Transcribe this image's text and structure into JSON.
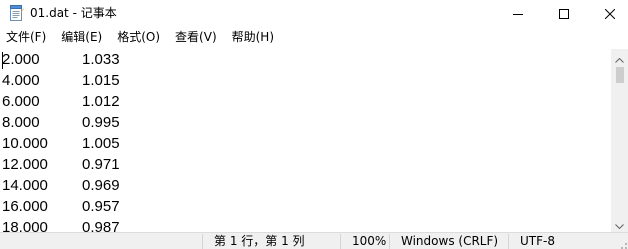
{
  "window": {
    "title": "01.dat - 记事本"
  },
  "menu": {
    "file": "文件(F)",
    "edit": "编辑(E)",
    "format": "格式(O)",
    "view": "查看(V)",
    "help": "帮助(H)"
  },
  "editor": {
    "rows": [
      {
        "x": "2.000",
        "y": "1.033"
      },
      {
        "x": "4.000",
        "y": "1.015"
      },
      {
        "x": "6.000",
        "y": "1.012"
      },
      {
        "x": "8.000",
        "y": "0.995"
      },
      {
        "x": "10.000",
        "y": "1.005"
      },
      {
        "x": "12.000",
        "y": "0.971"
      },
      {
        "x": "14.000",
        "y": "0.969"
      },
      {
        "x": "16.000",
        "y": "0.957"
      },
      {
        "x": "18.000",
        "y": "0.987"
      }
    ]
  },
  "status": {
    "position": "第 1 行，第 1 列",
    "zoom": "100%",
    "line_ending": "Windows (CRLF)",
    "encoding": "UTF-8"
  },
  "icons": {
    "app": "notepad-icon",
    "minimize": "minimize-icon",
    "maximize": "maximize-icon",
    "close": "close-icon"
  }
}
